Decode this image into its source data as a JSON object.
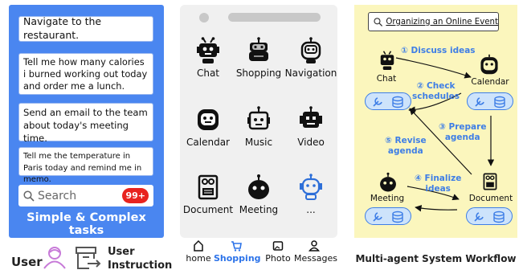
{
  "tasks": {
    "items": [
      "Navigate to the restaurant.",
      "Tell me how many calories i burned working out today and order me a lunch.",
      "Send an email to the team about today's meeting time.",
      "Tell me the temperature in Paris today and remind me in memo."
    ],
    "search_placeholder": "Search",
    "badge": "99+",
    "footer": "Simple & Complex tasks"
  },
  "legend": {
    "user": "User",
    "instruction_line1": "User",
    "instruction_line2": "Instruction"
  },
  "phone": {
    "apps": [
      "Chat",
      "Shopping",
      "Navigation",
      "Calendar",
      "Music",
      "Video",
      "Document",
      "Meeting",
      "..."
    ],
    "nav": [
      {
        "label": "home",
        "icon": "home-icon",
        "active": false
      },
      {
        "label": "Shopping",
        "icon": "cart-icon",
        "active": true
      },
      {
        "label": "Photo",
        "icon": "photo-icon",
        "active": false
      },
      {
        "label": "Messages",
        "icon": "user-icon",
        "active": false
      }
    ]
  },
  "workflow": {
    "title": "Organizing an Online Event",
    "agents": {
      "chat": "Chat",
      "calendar": "Calendar",
      "meeting": "Meeting",
      "document": "Document"
    },
    "steps": {
      "s1": "① Discuss ideas",
      "s2_line1": "② Check",
      "s2_line2": "schedules",
      "s3_line1": "③ Prepare",
      "s3_line2": "agenda",
      "s4_line1": "④ Finalize",
      "s4_line2": "ideas",
      "s5_line1": "⑤ Revise",
      "s5_line2": "agenda"
    },
    "caption": "Multi-agent System Workflow",
    "accent": "#3e7ee6",
    "background": "#fbf6bd"
  },
  "colors": {
    "left_panel": "#4A86F0",
    "badge": "#e8231f",
    "nav_active": "#2c73e9"
  }
}
